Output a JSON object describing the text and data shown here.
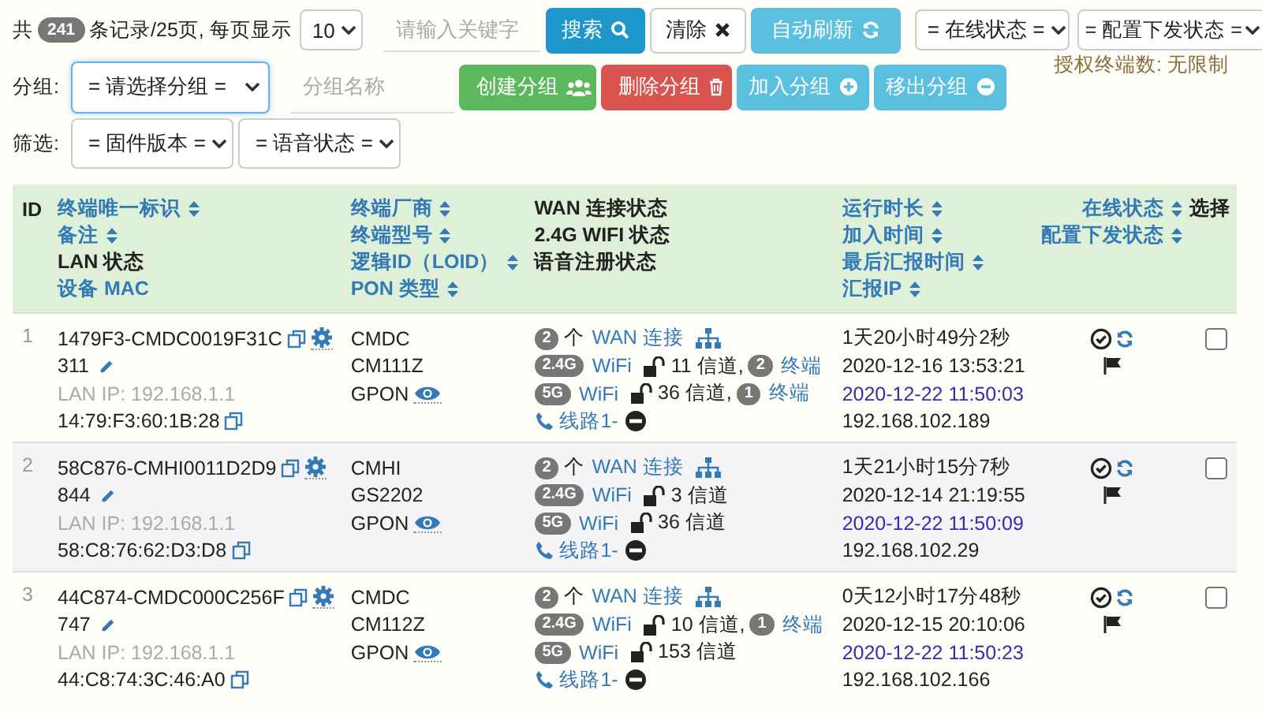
{
  "toolbar": {
    "total_prefix": "共",
    "total_badge": "241",
    "total_suffix": "条记录/25页, 每页显示",
    "page_size": "10",
    "keyword": {
      "placeholder": "请输入关键字"
    },
    "buttons": [
      {
        "label": "搜索",
        "kind": "search"
      },
      {
        "label": "清除",
        "kind": "clear"
      },
      {
        "label": "自动刷新",
        "kind": "refresh"
      }
    ],
    "filters_right": [
      "= 在线状态 =",
      "= 配置下发状态 ="
    ],
    "license": "授权终端数: 无限制"
  },
  "group_bar": {
    "label": "分组:",
    "select": {
      "value": "= 请选择分组 =",
      "focused": true
    },
    "name_field": {
      "placeholder": "分组名称"
    },
    "buttons": [
      {
        "label": "创建分组",
        "kind": "create"
      },
      {
        "label": "删除分组",
        "kind": "delete"
      },
      {
        "label": "加入分组",
        "kind": "add"
      },
      {
        "label": "移出分组",
        "kind": "remove"
      }
    ]
  },
  "filter_bar": {
    "label": "筛选:",
    "selects": [
      "= 固件版本 =",
      "= 语音状态 ="
    ]
  },
  "table": {
    "columns": [
      [
        {
          "text": "ID",
          "kind": "plain"
        }
      ],
      [
        {
          "text": "终端唯一标识",
          "kind": "sort"
        },
        {
          "text": "备注",
          "kind": "sort"
        },
        {
          "text": "LAN 状态",
          "kind": "plain"
        },
        {
          "text": "设备 MAC",
          "kind": "link"
        }
      ],
      [
        {
          "text": "终端厂商",
          "kind": "sort"
        },
        {
          "text": "终端型号",
          "kind": "sort"
        },
        {
          "text": "逻辑ID（LOID）",
          "kind": "sort"
        },
        {
          "text": "PON 类型",
          "kind": "sort"
        }
      ],
      [
        {
          "text": "WAN 连接状态",
          "kind": "plain"
        },
        {
          "text": "2.4G WIFI 状态",
          "kind": "plain"
        },
        {
          "text": "语音注册状态",
          "kind": "plain"
        }
      ],
      [
        {
          "text": "运行时长",
          "kind": "sort"
        },
        {
          "text": "加入时间",
          "kind": "sort"
        },
        {
          "text": "最后汇报时间",
          "kind": "sort"
        },
        {
          "text": "汇报IP",
          "kind": "sort"
        }
      ],
      [
        {
          "text": "在线状态",
          "kind": "sort"
        },
        {
          "text": "配置下发状态",
          "kind": "sort"
        }
      ],
      [
        {
          "text": "选择",
          "kind": "plain"
        }
      ]
    ],
    "rows": [
      {
        "id": "1",
        "terminal_id": "1479F3-CMDC0019F31C",
        "remark": "311",
        "lan_ip": "LAN IP: 192.168.1.1",
        "mac": "14:79:F3:60:1B:28",
        "vendor": "CMDC",
        "model": "CM111Z",
        "pon": "GPON",
        "wan_count": "2",
        "wan_unit": "个",
        "wan_link": "WAN 连接",
        "wifi": [
          {
            "band": "2.4G",
            "label": "WiFi",
            "channel": "11 信道,",
            "clients": "2",
            "clients_label": "终端"
          },
          {
            "band": "5G",
            "label": "WiFi",
            "channel": "36 信道,",
            "clients": "1",
            "clients_label": "终端"
          }
        ],
        "voice": "线路1-",
        "uptime": "1天20小时49分2秒",
        "joined": "2020-12-16 13:53:21",
        "last_report": "2020-12-22 11:50:03",
        "report_ip": "192.168.102.189",
        "checked": false
      },
      {
        "id": "2",
        "terminal_id": "58C876-CMHI0011D2D9",
        "remark": "844",
        "lan_ip": "LAN IP: 192.168.1.1",
        "mac": "58:C8:76:62:D3:D8",
        "vendor": "CMHI",
        "model": "GS2202",
        "pon": "GPON",
        "wan_count": "2",
        "wan_unit": "个",
        "wan_link": "WAN 连接",
        "wifi": [
          {
            "band": "2.4G",
            "label": "WiFi",
            "channel": "3 信道"
          },
          {
            "band": "5G",
            "label": "WiFi",
            "channel": "36 信道"
          }
        ],
        "voice": "线路1-",
        "uptime": "1天21小时15分7秒",
        "joined": "2020-12-14 21:19:55",
        "last_report": "2020-12-22 11:50:09",
        "report_ip": "192.168.102.29",
        "checked": false
      },
      {
        "id": "3",
        "terminal_id": "44C874-CMDC000C256F",
        "remark": "747",
        "lan_ip": "LAN IP: 192.168.1.1",
        "mac": "44:C8:74:3C:46:A0",
        "vendor": "CMDC",
        "model": "CM112Z",
        "pon": "GPON",
        "wan_count": "2",
        "wan_unit": "个",
        "wan_link": "WAN 连接",
        "wifi": [
          {
            "band": "2.4G",
            "label": "WiFi",
            "channel": "10 信道,",
            "clients": "1",
            "clients_label": "终端"
          },
          {
            "band": "5G",
            "label": "WiFi",
            "channel": "153 信道"
          }
        ],
        "voice": "线路1-",
        "uptime": "0天12小时17分48秒",
        "joined": "2020-12-15 20:10:06",
        "last_report": "2020-12-22 11:50:23",
        "report_ip": "192.168.102.166",
        "checked": false
      }
    ]
  }
}
